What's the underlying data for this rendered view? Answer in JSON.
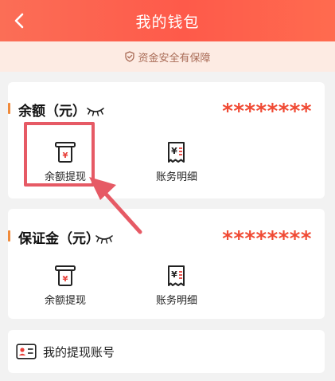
{
  "header": {
    "title": "我的钱包",
    "back_icon": "chevron-left-icon"
  },
  "safety_banner": {
    "text": "资金安全有保障",
    "icon": "shield-check-icon"
  },
  "balance_card": {
    "title": "余额（元）",
    "amount": "********",
    "eye_icon": "eye-closed-icon",
    "actions": [
      {
        "label": "余额提现",
        "icon": "withdraw-icon"
      },
      {
        "label": "账务明细",
        "icon": "bill-detail-icon"
      }
    ]
  },
  "deposit_card": {
    "title": "保证金（元）",
    "amount": "********",
    "eye_icon": "eye-closed-icon",
    "actions": [
      {
        "label": "余额提现",
        "icon": "withdraw-icon"
      },
      {
        "label": "账务明细",
        "icon": "bill-detail-icon"
      }
    ]
  },
  "account_row": {
    "label": "我的提现账号",
    "icon": "id-card-icon"
  },
  "colors": {
    "header_gradient_start": "#fb6e56",
    "header_gradient_end": "#ff6b4f",
    "amount": "#f04a34",
    "accent": "#f08a3a",
    "annotation": "#e65a65",
    "banner_bg": "#fdebe3",
    "banner_text": "#a86a55"
  }
}
